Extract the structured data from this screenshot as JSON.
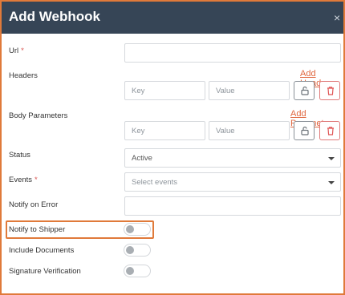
{
  "dialog": {
    "title": "Add Webhook",
    "close_glyph": "×"
  },
  "fields": {
    "url": {
      "label": "Url",
      "required_mark": "*",
      "value": ""
    },
    "headers": {
      "label": "Headers",
      "add_link": "Add Header",
      "key_placeholder": "Key",
      "value_placeholder": "Value"
    },
    "body_parameters": {
      "label": "Body Parameters",
      "add_link": "Add Parameter",
      "key_placeholder": "Key",
      "value_placeholder": "Value"
    },
    "status": {
      "label": "Status",
      "selected": "Active"
    },
    "events": {
      "label": "Events",
      "required_mark": "*",
      "placeholder": "Select events"
    },
    "notify_on_error": {
      "label": "Notify on Error",
      "value": ""
    },
    "notify_to_shipper": {
      "label": "Notify to Shipper",
      "enabled": false
    },
    "include_documents": {
      "label": "Include Documents",
      "enabled": false
    },
    "signature_verification": {
      "label": "Signature Verification",
      "enabled": false
    }
  },
  "colors": {
    "header_bg": "#364556",
    "accent": "#e07a3a",
    "link": "#e0673f",
    "danger": "#e05555"
  },
  "icons": [
    "close-icon",
    "unlock-icon",
    "trash-icon",
    "chevron-down-icon"
  ]
}
